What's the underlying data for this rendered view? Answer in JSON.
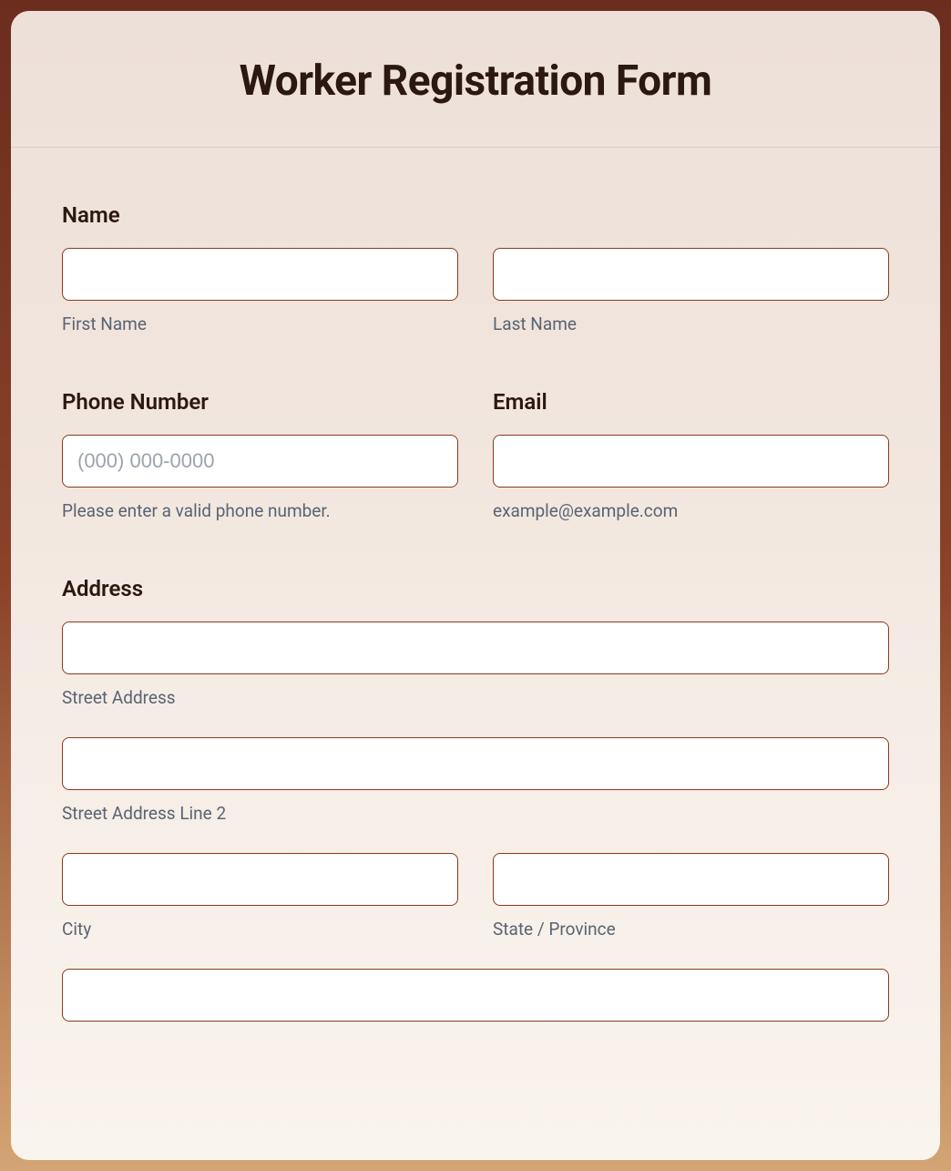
{
  "header": {
    "title": "Worker Registration Form"
  },
  "sections": {
    "name": {
      "label": "Name",
      "first_name_sublabel": "First Name",
      "last_name_sublabel": "Last Name"
    },
    "phone": {
      "label": "Phone Number",
      "placeholder": "(000) 000-0000",
      "sublabel": "Please enter a valid phone number."
    },
    "email": {
      "label": "Email",
      "sublabel": "example@example.com"
    },
    "address": {
      "label": "Address",
      "street_sublabel": "Street Address",
      "street2_sublabel": "Street Address Line 2",
      "city_sublabel": "City",
      "state_sublabel": "State / Province"
    }
  }
}
